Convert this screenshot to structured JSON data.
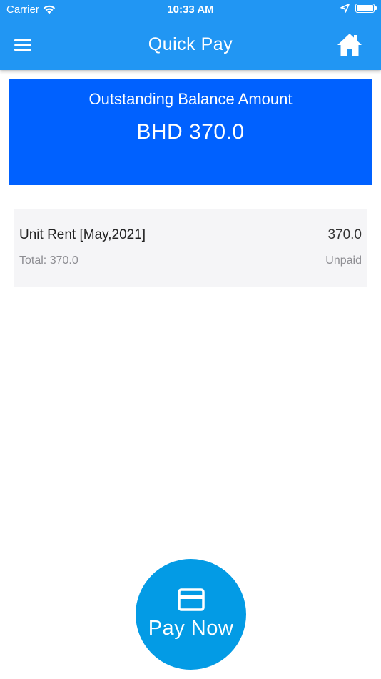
{
  "status_bar": {
    "carrier": "Carrier",
    "time": "10:33 AM"
  },
  "app_bar": {
    "title": "Quick Pay",
    "color": "#2196f3"
  },
  "balance": {
    "label": "Outstanding Balance Amount",
    "amount": "BHD 370.0",
    "color": "#0061ff"
  },
  "invoice_items": [
    {
      "description": "Unit Rent [May,2021]",
      "amount": "370.0",
      "total": "Total: 370.0",
      "status": "Unpaid"
    }
  ],
  "pay_button": {
    "label": "Pay Now",
    "icon": "credit-card-icon",
    "color": "#039be5"
  },
  "icons": [
    "wifi-icon",
    "location-arrow-icon",
    "battery-icon",
    "menu-icon",
    "home-icon",
    "credit-card-icon"
  ]
}
